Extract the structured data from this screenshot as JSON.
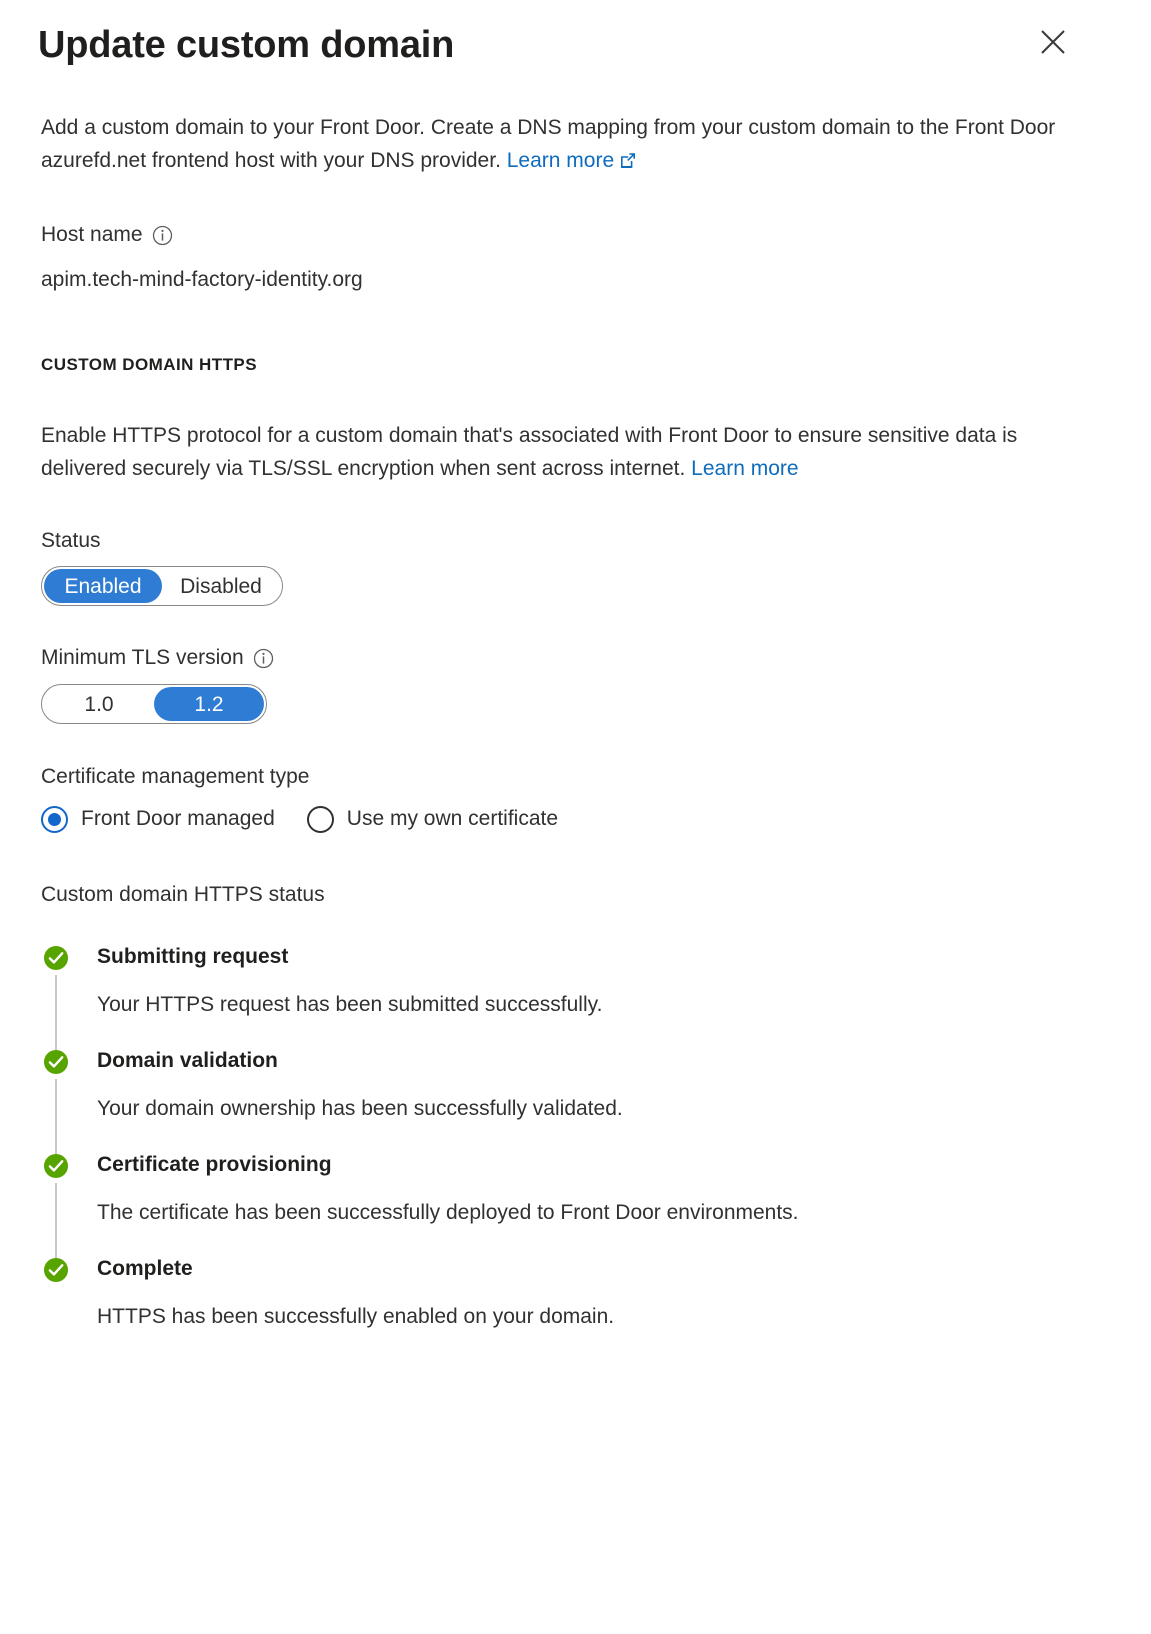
{
  "header": {
    "title": "Update custom domain",
    "close_label": "Close"
  },
  "intro": {
    "text_before_link": "Add a custom domain to your Front Door. Create a DNS mapping from your custom domain to the Front Door azurefd.net frontend host with your DNS provider. ",
    "link_label": "Learn more"
  },
  "host_name": {
    "label": "Host name",
    "value": "apim.tech-mind-factory-identity.org"
  },
  "https_section": {
    "heading": "CUSTOM DOMAIN HTTPS",
    "description_before_link": "Enable HTTPS protocol for a custom domain that's associated with Front Door to ensure sensitive data is delivered securely via TLS/SSL encryption when sent across internet. ",
    "description_link_label": "Learn more"
  },
  "status_toggle": {
    "label": "Status",
    "options": [
      "Enabled",
      "Disabled"
    ],
    "selected": "Enabled"
  },
  "tls_toggle": {
    "label": "Minimum TLS version",
    "options": [
      "1.0",
      "1.2"
    ],
    "selected": "1.2"
  },
  "certificate_management": {
    "label": "Certificate management type",
    "options": [
      {
        "label": "Front Door managed",
        "selected": true
      },
      {
        "label": "Use my own certificate",
        "selected": false
      }
    ]
  },
  "https_status": {
    "heading": "Custom domain HTTPS status",
    "steps": [
      {
        "title": "Submitting request",
        "description": "Your HTTPS request has been submitted successfully.",
        "state": "complete"
      },
      {
        "title": "Domain validation",
        "description": "Your domain ownership has been successfully validated.",
        "state": "complete"
      },
      {
        "title": "Certificate provisioning",
        "description": "The certificate has been successfully deployed to Front Door environments.",
        "state": "complete"
      },
      {
        "title": "Complete",
        "description": "HTTPS has been successfully enabled on your domain.",
        "state": "complete"
      }
    ]
  },
  "colors": {
    "accent_blue": "#0f6cbd",
    "toggle_blue": "#2f7cd4",
    "radio_blue": "#1366ca",
    "success_green": "#57a300",
    "text": "#323130",
    "connector": "#c8c6c4"
  }
}
